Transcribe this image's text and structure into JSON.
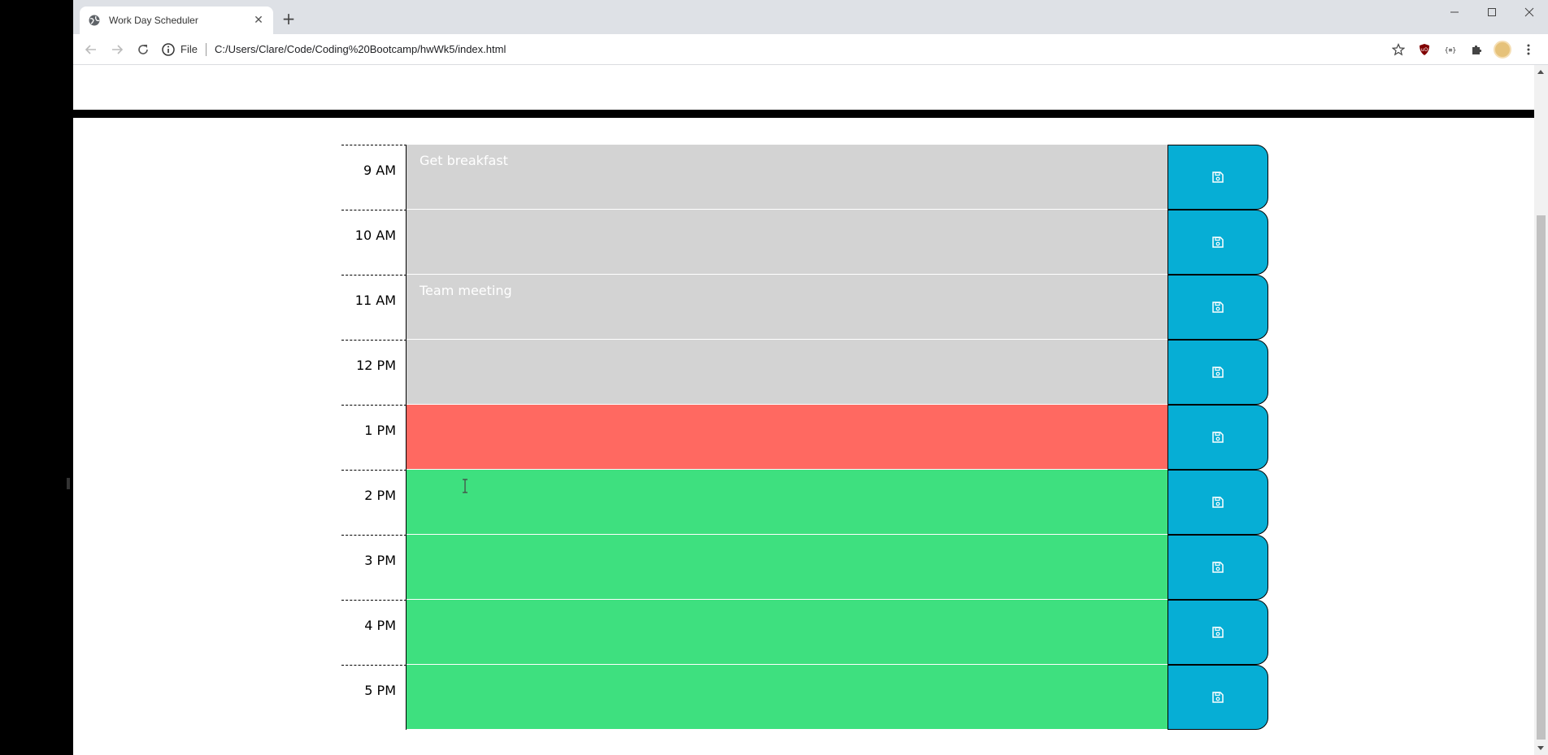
{
  "browser": {
    "tab_title": "Work Day Scheduler",
    "address_scheme": "File",
    "url": "C:/Users/Clare/Code/Coding%20Bootcamp/hwWk5/index.html"
  },
  "scheduler": {
    "rows": [
      {
        "hour": "9 AM",
        "text": "Get breakfast",
        "state": "past"
      },
      {
        "hour": "10 AM",
        "text": "",
        "state": "past"
      },
      {
        "hour": "11 AM",
        "text": "Team meeting",
        "state": "past"
      },
      {
        "hour": "12 PM",
        "text": "",
        "state": "past"
      },
      {
        "hour": "1 PM",
        "text": "",
        "state": "present"
      },
      {
        "hour": "2 PM",
        "text": "",
        "state": "future"
      },
      {
        "hour": "3 PM",
        "text": "",
        "state": "future"
      },
      {
        "hour": "4 PM",
        "text": "",
        "state": "future"
      },
      {
        "hour": "5 PM",
        "text": "",
        "state": "future"
      }
    ]
  },
  "colors": {
    "past": "#d3d3d3",
    "present": "#ff6961",
    "future": "#3ee07f",
    "save_button": "#06aed5"
  },
  "icons": {
    "save": "save-icon"
  }
}
